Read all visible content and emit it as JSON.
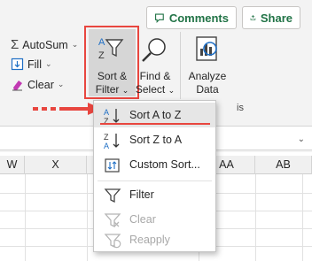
{
  "topbar": {
    "comments_label": "Comments",
    "share_label": "Share"
  },
  "editing": {
    "autosum_label": "AutoSum",
    "fill_label": "Fill",
    "clear_label": "Clear"
  },
  "ribbon": {
    "sort_filter_line1": "Sort &",
    "sort_filter_line2": "Filter",
    "find_select_line1": "Find &",
    "find_select_line2": "Select",
    "analyze_line1": "Analyze",
    "analyze_line2": "Data",
    "group_label_partial": "is"
  },
  "columns": [
    "W",
    "X",
    "AA",
    "AB"
  ],
  "menu": {
    "items": [
      {
        "label": "Sort A to Z",
        "enabled": true
      },
      {
        "label": "Sort Z to A",
        "enabled": true
      },
      {
        "label": "Custom Sort...",
        "enabled": true
      },
      {
        "label": "Filter",
        "enabled": true
      },
      {
        "label": "Clear",
        "enabled": false
      },
      {
        "label": "Reapply",
        "enabled": false
      }
    ]
  },
  "colors": {
    "accent_green": "#217346",
    "highlight_red": "#e8463f",
    "sort_icon_blue": "#1f6fc5"
  }
}
